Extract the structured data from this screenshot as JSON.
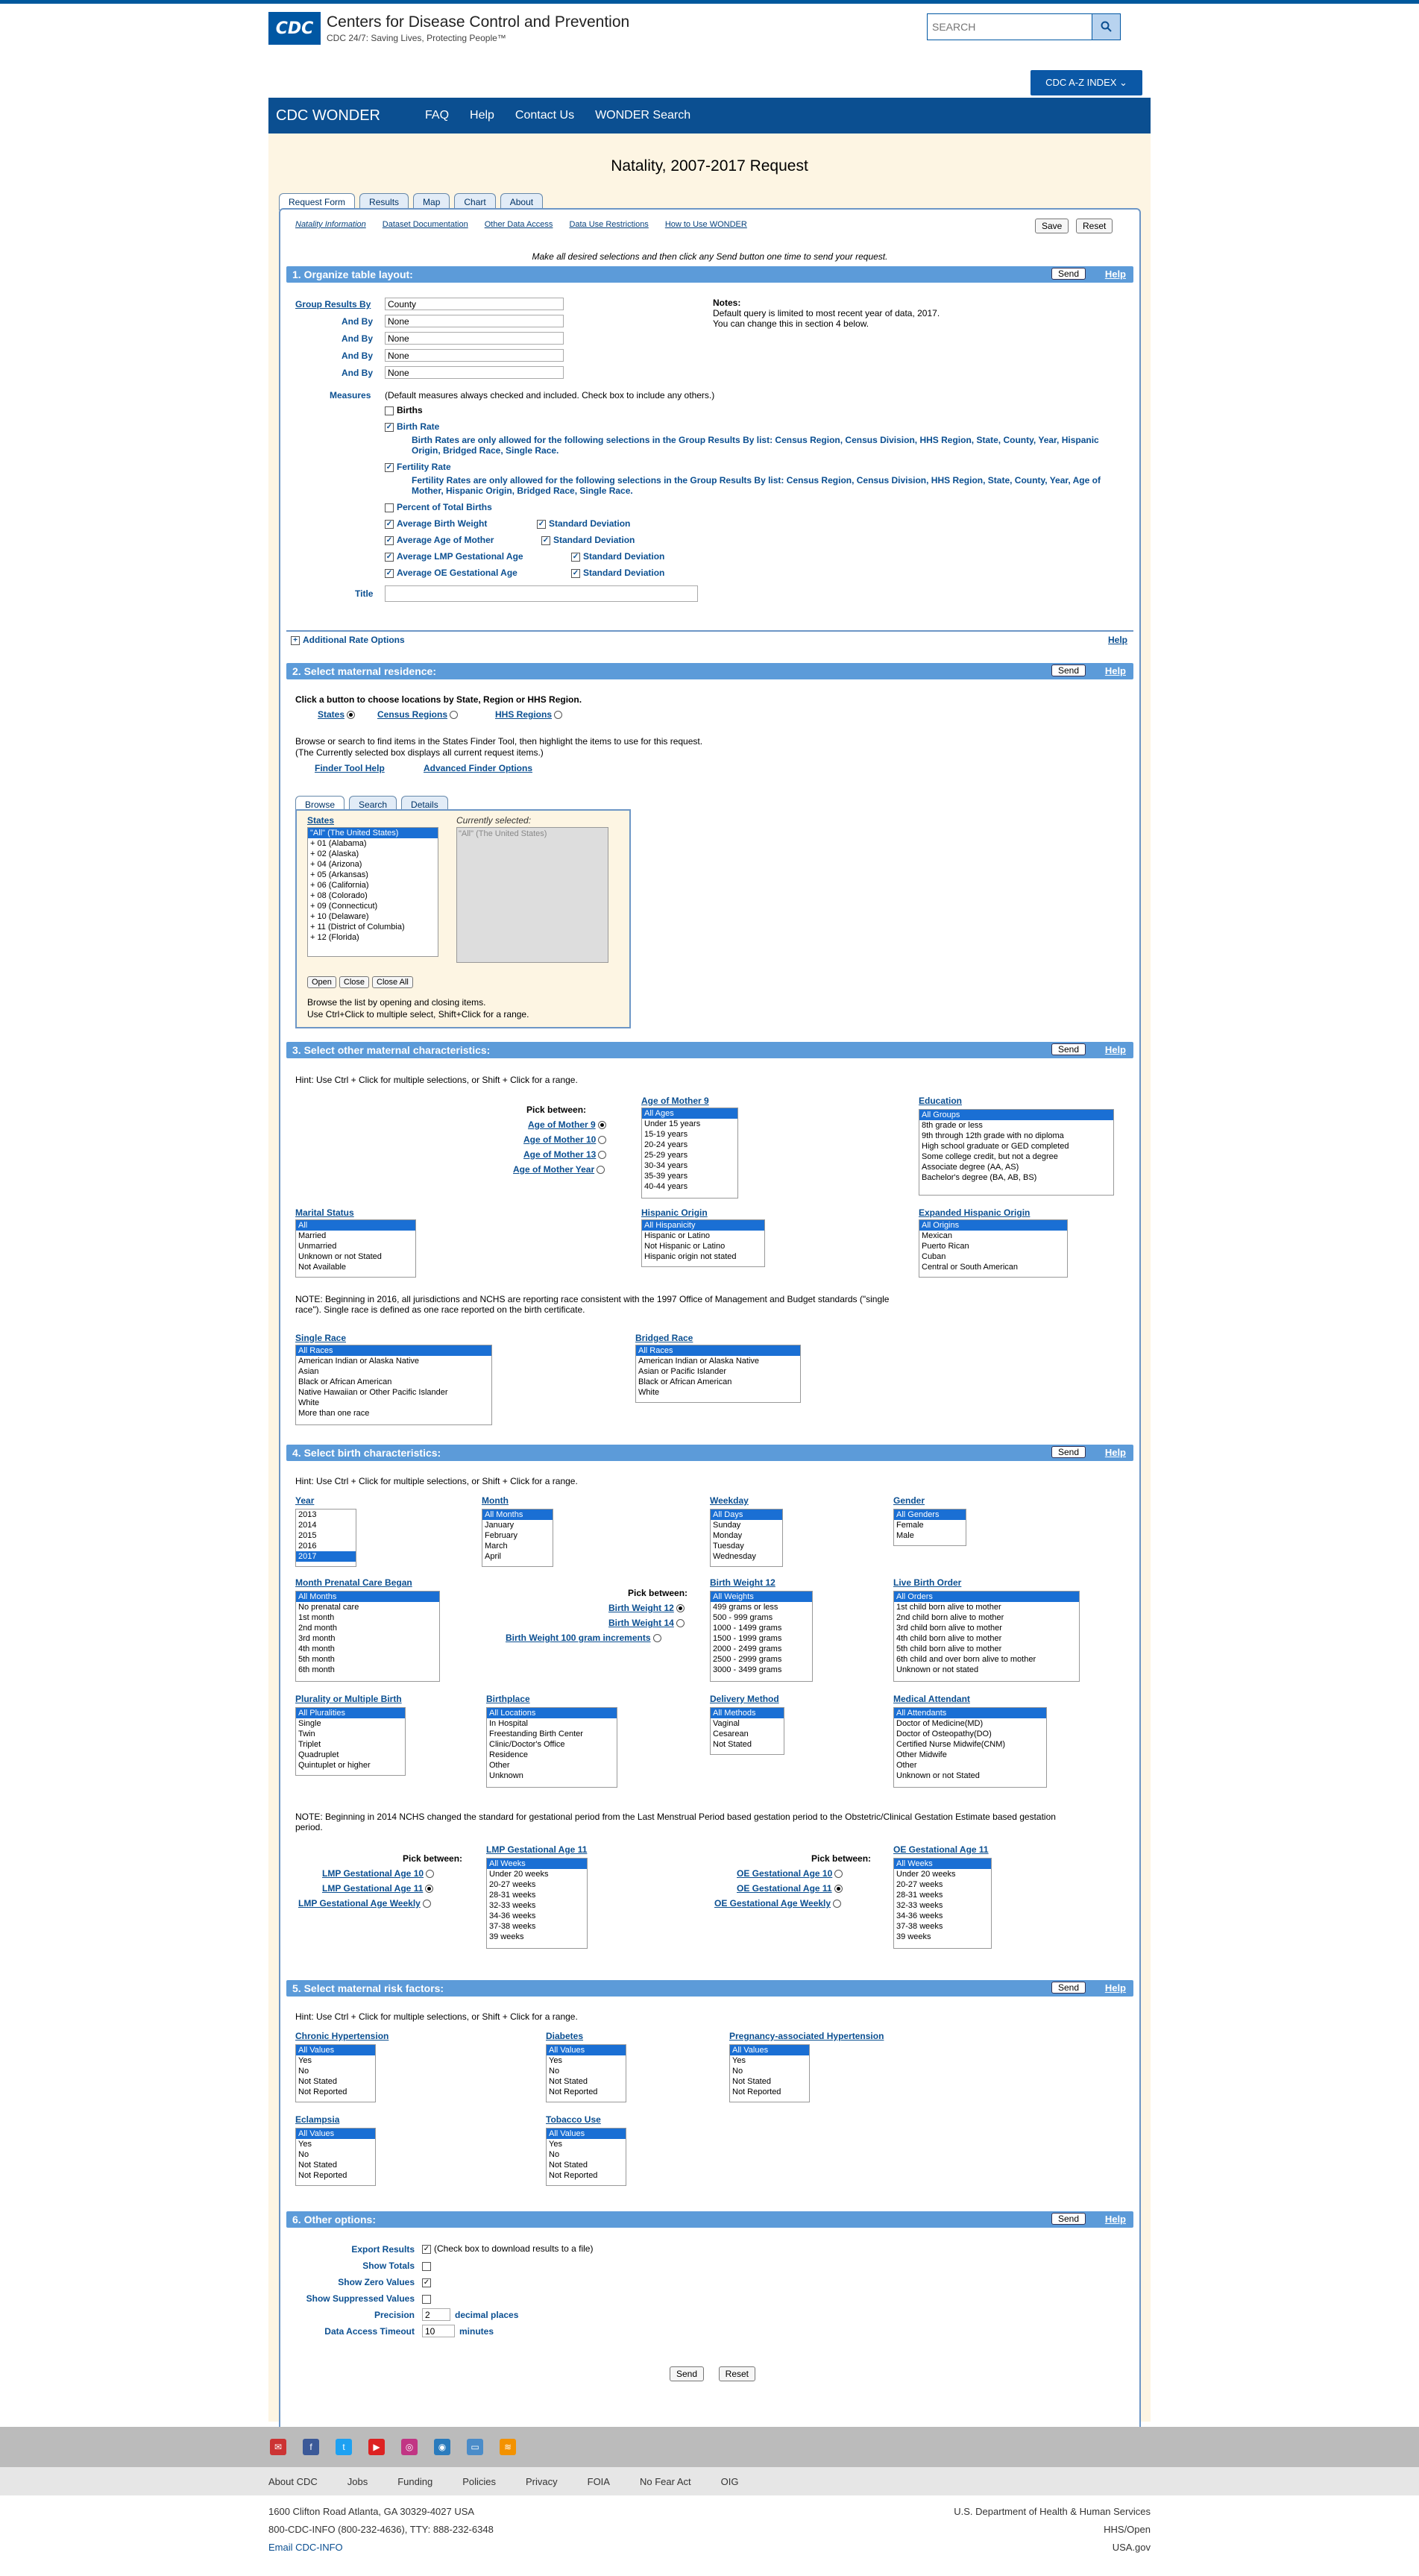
{
  "header": {
    "logo": "CDC",
    "org": "Centers for Disease Control and Prevention",
    "tagline": "CDC 24/7: Saving Lives, Protecting People™",
    "search_placeholder": "SEARCH",
    "az": "CDC A-Z INDEX ⌄"
  },
  "nav": {
    "brand": "CDC WONDER",
    "links": [
      "FAQ",
      "Help",
      "Contact Us",
      "WONDER Search"
    ]
  },
  "page": {
    "title": "Natality, 2007-2017 Request",
    "tabs": [
      "Request Form",
      "Results",
      "Map",
      "Chart",
      "About"
    ]
  },
  "toplinks": [
    "Natality Information",
    "Dataset Documentation",
    "Other Data Access",
    "Data Use Restrictions",
    "How to Use WONDER"
  ],
  "buttons": {
    "save": "Save",
    "reset": "Reset",
    "send": "Send",
    "help": "Help"
  },
  "intro": "Make all desired selections and then click any Send button one time to send your request.",
  "s1": {
    "title": "1. Organize table layout:",
    "group_by": "Group Results By",
    "and_by": "And By",
    "group_value": "County",
    "none": "None",
    "notes_title": "Notes:",
    "notes": [
      "Default query is limited to most recent year of data, 2017.",
      "You can change this in section 4 below."
    ],
    "measures": "Measures",
    "measures_note": "(Default measures always checked and included. Check box to include any others.)",
    "births": "Births",
    "birth_rate": "Birth Rate",
    "br_note": "Birth Rates are only allowed for the following selections in the Group Results By list: Census Region, Census Division, HHS Region, State, County, Year, Hispanic Origin, Bridged Race, Single Race.",
    "fertility_rate": "Fertility Rate",
    "fr_note": "Fertility Rates are only allowed for the following selections in the Group Results By list: Census Region, Census Division, HHS Region, State, County, Year, Age of Mother, Hispanic Origin, Bridged Race, Single Race.",
    "pct": "Percent of Total Births",
    "m1": "Average Birth Weight",
    "m2": "Average Age of Mother",
    "m3": "Average LMP Gestational Age",
    "m4": "Average OE Gestational Age",
    "sd": "Standard Deviation",
    "title_label": "Title",
    "additional": "Additional Rate Options"
  },
  "s2": {
    "title": "2. Select maternal residence:",
    "click": "Click a button to choose locations by State, Region or HHS Region.",
    "opts": [
      "States",
      "Census Regions",
      "HHS Regions"
    ],
    "browse": "Browse or search to find items in the States Finder Tool, then highlight the items to use for this request.",
    "browse2": "(The Currently selected box displays all current request items.)",
    "finder": "Finder Tool Help",
    "adv": "Advanced Finder Options",
    "ftabs": [
      "Browse",
      "Search",
      "Details"
    ],
    "states": "States",
    "currently": "Currently selected:",
    "cur_value": "\"All\" (The United States)",
    "state_items": [
      "\"All\" (The United States)",
      "+ 01 (Alabama)",
      "+ 02 (Alaska)",
      "+ 04 (Arizona)",
      "+ 05 (Arkansas)",
      "+ 06 (California)",
      "+ 08 (Colorado)",
      "+ 09 (Connecticut)",
      "+ 10 (Delaware)",
      "+ 11 (District of Columbia)",
      "+ 12 (Florida)"
    ],
    "fbtns": [
      "Open",
      "Close",
      "Close All"
    ],
    "help1": "Browse the list by opening and closing items.",
    "help2": "Use Ctrl+Click to multiple select, Shift+Click for a range."
  },
  "s3": {
    "title": "3. Select other maternal characteristics:",
    "hint": "Hint: Use Ctrl + Click for multiple selections, or Shift + Click for a range.",
    "pick": "Pick between:",
    "age_opts": [
      "Age of Mother 9",
      "Age of Mother 10",
      "Age of Mother 13",
      "Age of Mother Year"
    ],
    "age_label": "Age of Mother 9",
    "age_items": [
      "All Ages",
      "Under 15 years",
      "15-19 years",
      "20-24 years",
      "25-29 years",
      "30-34 years",
      "35-39 years",
      "40-44 years"
    ],
    "edu_label": "Education",
    "edu_items": [
      "All Groups",
      "8th grade or less",
      "9th through 12th grade with no diploma",
      "High school graduate or GED completed",
      "Some college credit, but not a degree",
      "Associate degree (AA, AS)",
      "Bachelor's degree (BA, AB, BS)"
    ],
    "mar_label": "Marital Status",
    "mar_items": [
      "All",
      "Married",
      "Unmarried",
      "Unknown or not Stated",
      "Not Available"
    ],
    "hisp_label": "Hispanic Origin",
    "hisp_items": [
      "All Hispanicity",
      "Hispanic or Latino",
      "Not Hispanic or Latino",
      "Hispanic origin not stated"
    ],
    "exh_label": "Expanded Hispanic Origin",
    "exh_items": [
      "All Origins",
      "Mexican",
      "Puerto Rican",
      "Cuban",
      "Central or South American"
    ],
    "note": "NOTE: Beginning in 2016, all jurisdictions and NCHS are reporting race consistent with the 1997 Office of Management and Budget standards (\"single race\"). Single race is defined as one race reported on the birth certificate.",
    "sr_label": "Single Race",
    "sr_items": [
      "All Races",
      "American Indian or Alaska Native",
      "Asian",
      "Black or African American",
      "Native Hawaiian or Other Pacific Islander",
      "White",
      "More than one race"
    ],
    "br_label": "Bridged Race",
    "br_items": [
      "All Races",
      "American Indian or Alaska Native",
      "Asian or Pacific Islander",
      "Black or African American",
      "White"
    ]
  },
  "s4": {
    "title": "4. Select birth characteristics:",
    "year_label": "Year",
    "year_items": [
      "2013",
      "2014",
      "2015",
      "2016",
      "2017"
    ],
    "month_label": "Month",
    "month_items": [
      "All Months",
      "January",
      "February",
      "March",
      "April"
    ],
    "wd_label": "Weekday",
    "wd_items": [
      "All Days",
      "Sunday",
      "Monday",
      "Tuesday",
      "Wednesday"
    ],
    "gen_label": "Gender",
    "gen_items": [
      "All Genders",
      "Female",
      "Male"
    ],
    "mpc_label": "Month Prenatal Care Began",
    "mpc_items": [
      "All Months",
      "No prenatal care",
      "1st month",
      "2nd month",
      "3rd month",
      "4th month",
      "5th month",
      "6th month"
    ],
    "bw_opts": [
      "Birth Weight 12",
      "Birth Weight 14",
      "Birth Weight 100 gram increments"
    ],
    "bw_label": "Birth Weight 12",
    "bw_items": [
      "All Weights",
      "499 grams or less",
      "500 - 999 grams",
      "1000 - 1499 grams",
      "1500 - 1999 grams",
      "2000 - 2499 grams",
      "2500 - 2999 grams",
      "3000 - 3499 grams"
    ],
    "lbo_label": "Live Birth Order",
    "lbo_items": [
      "All Orders",
      "1st child born alive to mother",
      "2nd child born alive to mother",
      "3rd child born alive to mother",
      "4th child born alive to mother",
      "5th child born alive to mother",
      "6th child and over born alive to mother",
      "Unknown or not stated"
    ],
    "plu_label": "Plurality or Multiple Birth",
    "plu_items": [
      "All Pluralities",
      "Single",
      "Twin",
      "Triplet",
      "Quadruplet",
      "Quintuplet or higher"
    ],
    "bp_label": "Birthplace",
    "bp_items": [
      "All Locations",
      "In Hospital",
      "Freestanding Birth Center",
      "Clinic/Doctor's Office",
      "Residence",
      "Other",
      "Unknown"
    ],
    "dm_label": "Delivery Method",
    "dm_items": [
      "All Methods",
      "Vaginal",
      "Cesarean",
      "Not Stated"
    ],
    "ma_label": "Medical Attendant",
    "ma_items": [
      "All Attendants",
      "Doctor of Medicine(MD)",
      "Doctor of Osteopathy(DO)",
      "Certified Nurse Midwife(CNM)",
      "Other Midwife",
      "Other",
      "Unknown or not Stated"
    ],
    "note": "NOTE: Beginning in 2014 NCHS changed the standard for gestational period from the Last Menstrual Period based gestation period to the Obstetric/Clinical Gestation Estimate based gestation period.",
    "lmp_opts": [
      "LMP Gestational Age 10",
      "LMP Gestational Age 11",
      "LMP Gestational Age Weekly"
    ],
    "lmp_label": "LMP Gestational Age 11",
    "oe_opts": [
      "OE Gestational Age 10",
      "OE Gestational Age 11",
      "OE Gestational Age Weekly"
    ],
    "oe_label": "OE Gestational Age 11",
    "ga_items": [
      "All Weeks",
      "Under 20 weeks",
      "20-27 weeks",
      "28-31 weeks",
      "32-33 weeks",
      "34-36 weeks",
      "37-38 weeks",
      "39 weeks"
    ]
  },
  "s5": {
    "title": "5. Select maternal risk factors:",
    "labels": [
      "Chronic Hypertension",
      "Diabetes",
      "Pregnancy-associated Hypertension",
      "Eclampsia",
      "Tobacco Use"
    ],
    "items": [
      "All Values",
      "Yes",
      "No",
      "Not Stated",
      "Not Reported"
    ]
  },
  "s6": {
    "title": "6. Other options:",
    "export": "Export Results",
    "export_note": "(Check box to download results to a file)",
    "totals": "Show Totals",
    "zero": "Show Zero Values",
    "supp": "Show Suppressed Values",
    "precision": "Precision",
    "prec_val": "2",
    "decimal": "decimal places",
    "timeout": "Data Access Timeout",
    "to_val": "10",
    "minutes": "minutes"
  },
  "footer": {
    "links": [
      "About CDC",
      "Jobs",
      "Funding",
      "Policies",
      "Privacy",
      "FOIA",
      "No Fear Act",
      "OIG"
    ],
    "addr": "1600 Clifton Road Atlanta, GA 30329-4027 USA",
    "phone": "800-CDC-INFO (800-232-4636), TTY: 888-232-6348",
    "email": "Email CDC-INFO",
    "right": [
      "U.S. Department of Health & Human Services",
      "HHS/Open",
      "USA.gov"
    ]
  }
}
